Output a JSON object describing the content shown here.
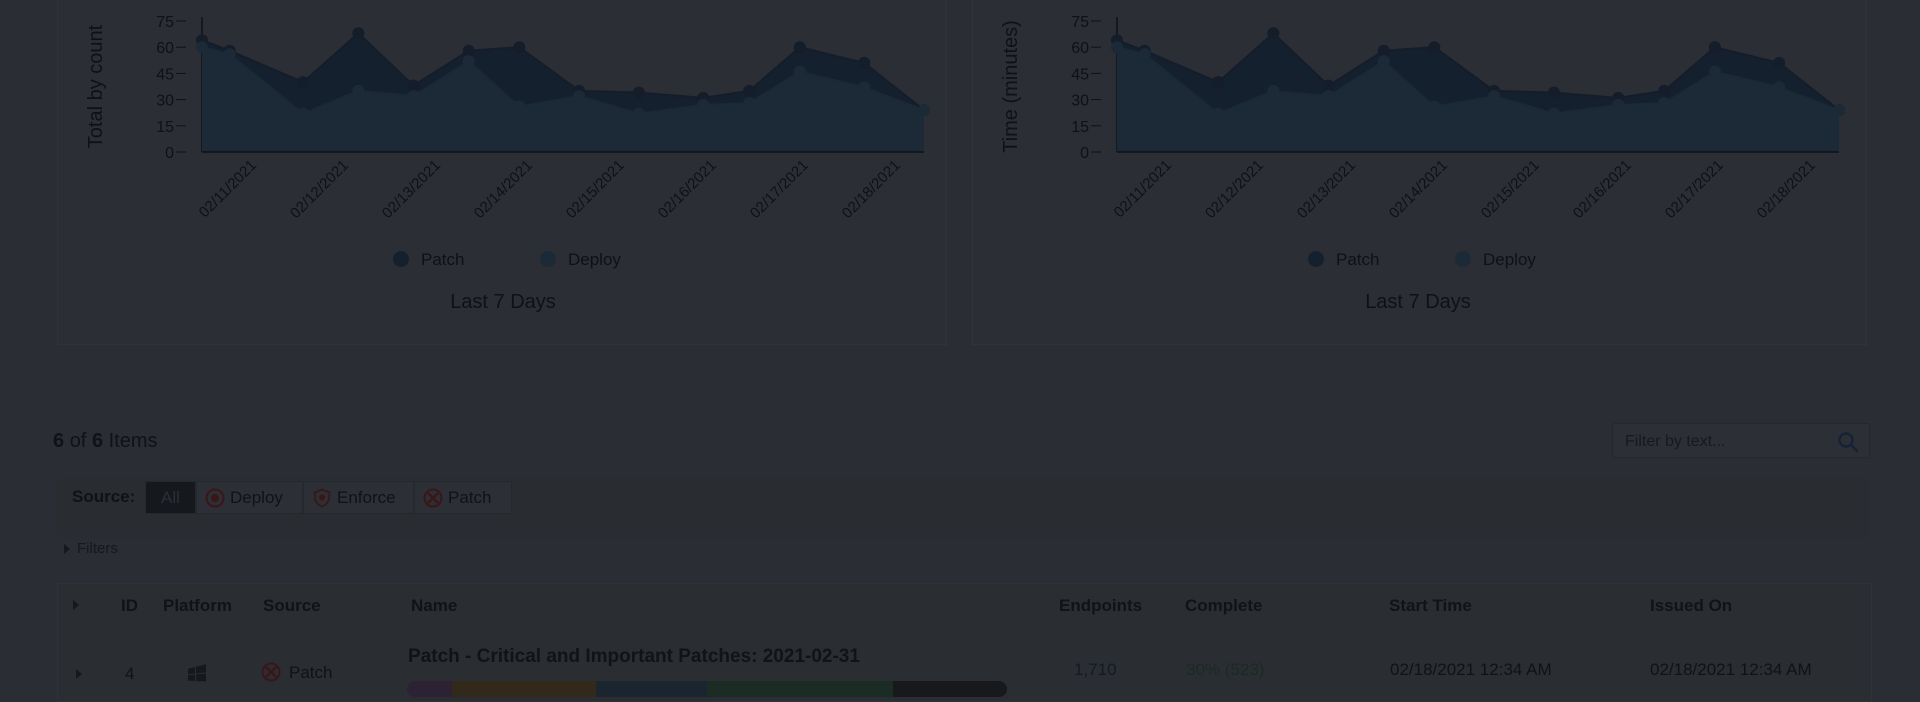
{
  "charts": [
    {
      "id": "count",
      "chart_data": {
        "type": "area",
        "ylabel": "Total by count",
        "xlabel": "Last 7 Days",
        "ylim": [
          0,
          75
        ],
        "yticks": [
          0,
          15,
          30,
          45,
          60,
          75
        ],
        "x_tick_labels": [
          "02/11/2021",
          "02/12/2021",
          "02/13/2021",
          "02/14/2021",
          "02/15/2021",
          "02/16/2021",
          "02/17/2021",
          "02/18/2021"
        ],
        "x": [
          0,
          0.3,
          1.1,
          1.7,
          2.3,
          2.9,
          3.45,
          4.1,
          4.75,
          5.45,
          5.95,
          6.5,
          7.2,
          7.85
        ],
        "series": [
          {
            "name": "Patch",
            "color": "#15202e",
            "values": [
              64,
              58,
              40,
              68,
              38,
              58,
              60,
              35,
              34,
              31,
              35,
              60,
              51,
              24
            ]
          },
          {
            "name": "Deploy",
            "color": "#1c2a37",
            "values": [
              60,
              56,
              22,
              35,
              32,
              52,
              26,
              32,
              22,
              27,
              28,
              46,
              37,
              24
            ]
          }
        ],
        "legend": "bottom"
      }
    },
    {
      "id": "time",
      "chart_data": {
        "type": "area",
        "ylabel": "Time (minutes)",
        "xlabel": "Last 7 Days",
        "ylim": [
          0,
          75
        ],
        "yticks": [
          0,
          15,
          30,
          45,
          60,
          75
        ],
        "x_tick_labels": [
          "02/11/2021",
          "02/12/2021",
          "02/13/2021",
          "02/14/2021",
          "02/15/2021",
          "02/16/2021",
          "02/17/2021",
          "02/18/2021"
        ],
        "x": [
          0,
          0.3,
          1.1,
          1.7,
          2.3,
          2.9,
          3.45,
          4.1,
          4.75,
          5.45,
          5.95,
          6.5,
          7.2,
          7.85
        ],
        "series": [
          {
            "name": "Patch",
            "color": "#15202e",
            "values": [
              64,
              58,
              40,
              68,
              38,
              58,
              60,
              35,
              34,
              31,
              35,
              60,
              51,
              24
            ]
          },
          {
            "name": "Deploy",
            "color": "#1c2a37",
            "values": [
              60,
              56,
              22,
              35,
              32,
              52,
              26,
              32,
              22,
              27,
              28,
              46,
              37,
              24
            ]
          }
        ],
        "legend": "bottom"
      }
    }
  ],
  "list": {
    "shown": "6",
    "of_text": "of",
    "total": "6",
    "items_text": "Items",
    "filter_placeholder": "Filter by text..."
  },
  "source": {
    "label": "Source:",
    "options": [
      "All",
      "Deploy",
      "Enforce",
      "Patch"
    ]
  },
  "filters_label": "Filters",
  "table": {
    "headers": {
      "id": "ID",
      "platform": "Platform",
      "source": "Source",
      "name": "Name",
      "endpoints": "Endpoints",
      "complete": "Complete",
      "start_time": "Start Time",
      "issued_on": "Issued On"
    },
    "rows": [
      {
        "id": "4",
        "platform_icon": "windows-icon",
        "source": "Patch",
        "name": "Patch - Critical and Important Patches: 2021-02-31",
        "endpoints": "1,710",
        "complete": "30% (523)",
        "start_time": "02/18/2021 12:34 AM",
        "issued_on": "02/18/2021 12:34 AM",
        "progress": [
          {
            "fraction": 0.075,
            "color": "#2d2234"
          },
          {
            "fraction": 0.24,
            "color": "#33291b"
          },
          {
            "fraction": 0.185,
            "color": "#1a2530"
          },
          {
            "fraction": 0.31,
            "color": "#1a2c23"
          },
          {
            "fraction": 0.19,
            "color": "#17191d"
          }
        ]
      }
    ]
  }
}
